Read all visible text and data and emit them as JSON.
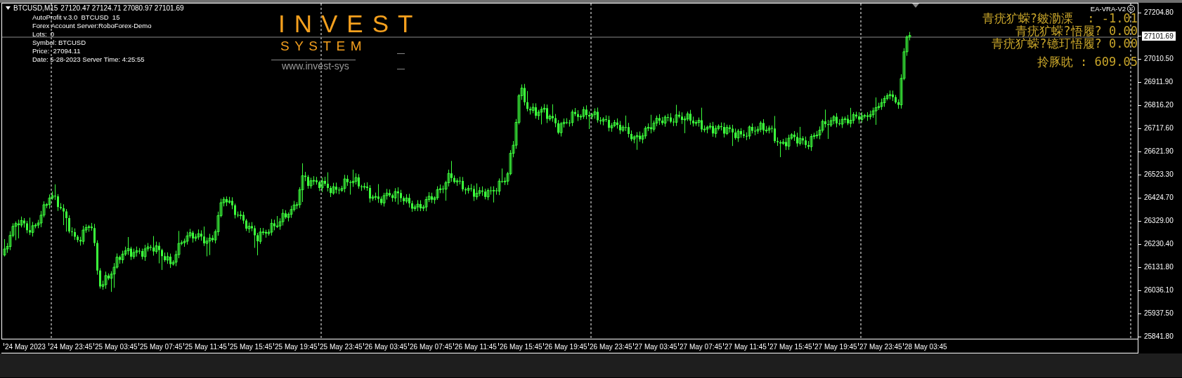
{
  "chart_header": {
    "symbol": "BTCUSD,M15",
    "ohlc": "27120.47 27124.71 27080.97 27101.69"
  },
  "indicator_info": [
    "AutoProfit v.3.0  BTCUSD  15",
    "Forex Account Server:RoboForex-Demo",
    "Lots:  0",
    "Symbol: BTCUSD",
    "Price:  27094.11",
    "Date: 5-28-2023 Server Time: 4:25:55"
  ],
  "logo": {
    "title": "INVEST",
    "subtitle": "SYSTEM",
    "url": "www.invest-sys"
  },
  "expert": {
    "name": "EA-VRA-V2"
  },
  "stats": [
    "青疣犷蝾?皴泐溧  : -1.01",
    "青疣犷蝾?悟履? 0.00",
    "青疣犷蝾?镱玎悟履? 0.00",
    "拎豚眈 : 609.05"
  ],
  "price_axis": [
    {
      "text": "27204.80",
      "kind": "tick"
    },
    {
      "text": "27101.69",
      "kind": "current"
    },
    {
      "text": "27010.50",
      "kind": "tick"
    },
    {
      "text": "26911.90",
      "kind": "tick"
    },
    {
      "text": "26816.20",
      "kind": "tick"
    },
    {
      "text": "26717.60",
      "kind": "tick"
    },
    {
      "text": "26621.90",
      "kind": "tick"
    },
    {
      "text": "26523.30",
      "kind": "tick"
    },
    {
      "text": "26424.70",
      "kind": "tick"
    },
    {
      "text": "26329.00",
      "kind": "tick"
    },
    {
      "text": "26230.40",
      "kind": "tick"
    },
    {
      "text": "26131.80",
      "kind": "tick"
    },
    {
      "text": "26036.10",
      "kind": "tick"
    },
    {
      "text": "25937.50",
      "kind": "tick"
    },
    {
      "text": "25841.80",
      "kind": "tick"
    }
  ],
  "time_axis": [
    "24 May 2023",
    "24 May 23:45",
    "25 May 03:45",
    "25 May 07:45",
    "25 May 11:45",
    "25 May 15:45",
    "25 May 19:45",
    "25 May 23:45",
    "26 May 03:45",
    "26 May 07:45",
    "26 May 11:45",
    "26 May 15:45",
    "26 May 19:45",
    "26 May 23:45",
    "27 May 03:45",
    "27 May 07:45",
    "27 May 11:45",
    "27 May 15:45",
    "27 May 19:45",
    "27 May 23:45",
    "28 May 03:45"
  ]
}
